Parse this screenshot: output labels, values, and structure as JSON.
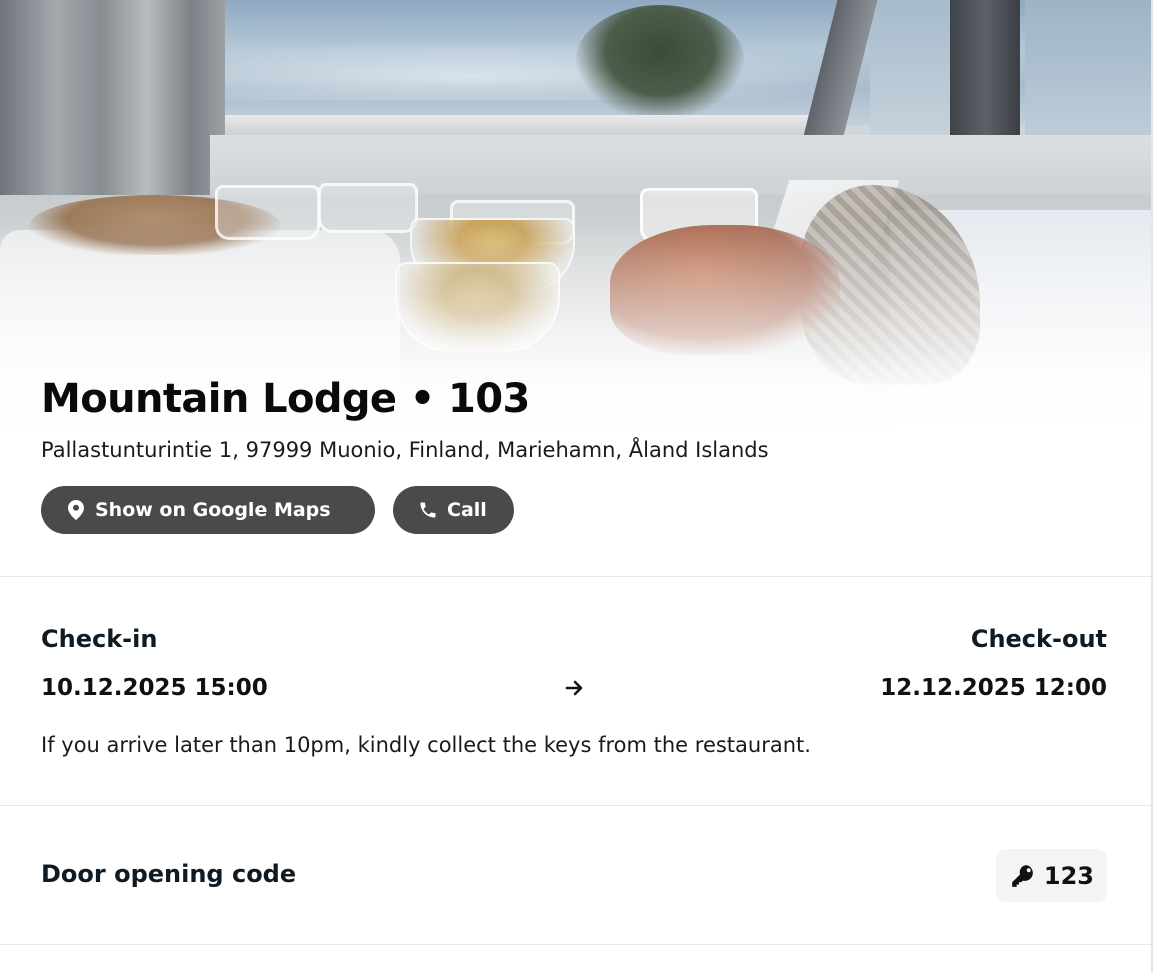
{
  "hero": {
    "image_name": "breakfast-by-the-lake-photo"
  },
  "property": {
    "title": "Mountain Lodge • 103",
    "address": "Pallastunturintie 1, 97999 Muonio, Finland, Mariehamn, Åland Islands"
  },
  "actions": {
    "maps_label": "Show on Google Maps",
    "maps_icon": "map-pin-icon",
    "call_label": "Call",
    "call_icon": "phone-icon",
    "button_color": "#4a4a4a"
  },
  "stay": {
    "checkin_label": "Check-in",
    "checkin_value": "10.12.2025 15:00",
    "checkout_label": "Check-out",
    "checkout_value": "12.12.2025 12:00",
    "arrow_icon": "arrow-right-icon",
    "note": "If you arrive later than 10pm, kindly collect the keys from the restaurant."
  },
  "door": {
    "label": "Door opening code",
    "code": "123",
    "icon": "key-icon"
  }
}
